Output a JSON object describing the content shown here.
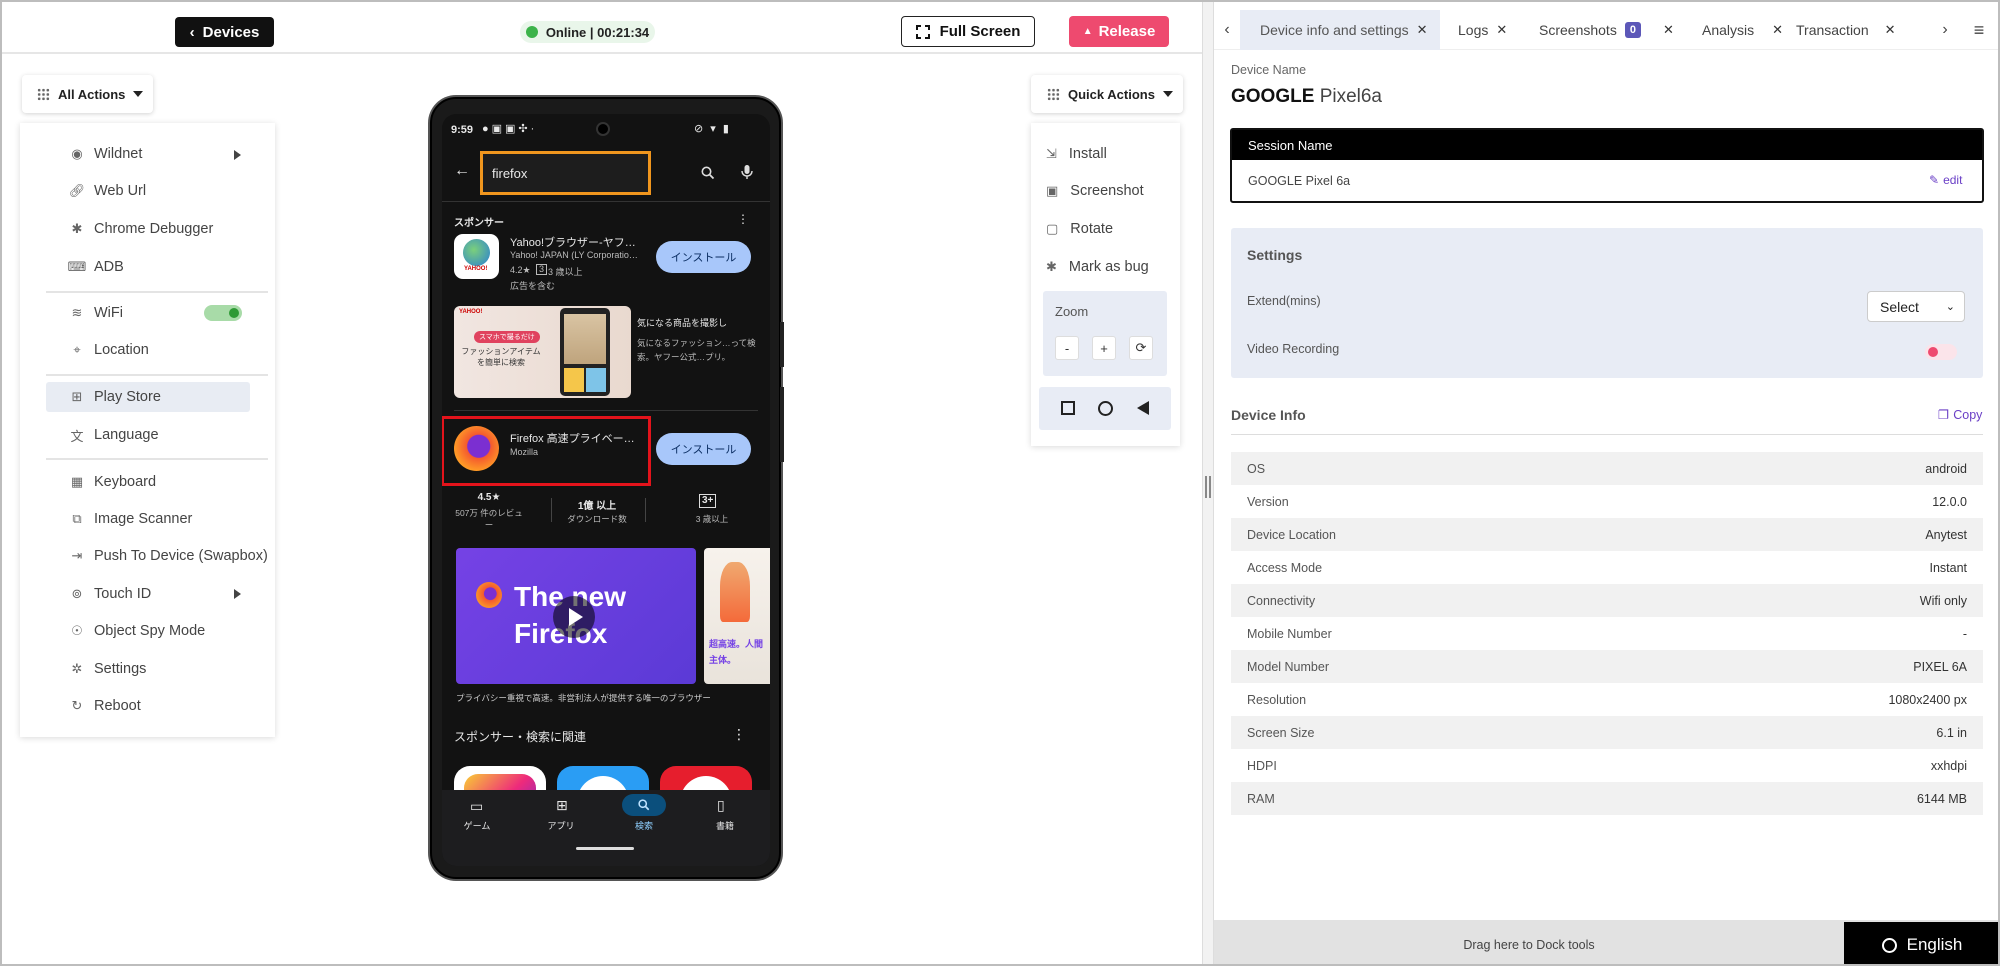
{
  "header": {
    "back_label": "Devices",
    "status_text": "Online | 00:21:34",
    "fullscreen_label": "Full Screen",
    "release_label": "Release"
  },
  "left_actions": {
    "button_label": "All Actions",
    "items": [
      {
        "label": "Wildnet",
        "icon": "signal-icon"
      },
      {
        "label": "Web Url",
        "icon": "link-icon"
      },
      {
        "label": "Chrome Debugger",
        "icon": "bug-icon"
      },
      {
        "label": "ADB",
        "icon": "terminal-icon"
      },
      {
        "label": "WiFi",
        "icon": "wifi-icon",
        "toggle": true
      },
      {
        "label": "Location",
        "icon": "location-pin-icon"
      },
      {
        "label": "Play Store",
        "icon": "apps-icon",
        "active": true
      },
      {
        "label": "Language",
        "icon": "language-icon"
      },
      {
        "label": "Keyboard",
        "icon": "keyboard-icon"
      },
      {
        "label": "Image Scanner",
        "icon": "image-scan-icon"
      },
      {
        "label": "Push To Device (Swapbox)",
        "icon": "push-icon"
      },
      {
        "label": "Touch ID",
        "icon": "fingerprint-icon"
      },
      {
        "label": "Object Spy Mode",
        "icon": "spy-icon"
      },
      {
        "label": "Settings",
        "icon": "gear-icon"
      },
      {
        "label": "Reboot",
        "icon": "reboot-icon"
      }
    ]
  },
  "phone": {
    "time": "9:59",
    "search_query": "firefox",
    "sponsor_label": "スポンサー",
    "yahoo_title": "Yahoo!ブラウザー-ヤフ…",
    "yahoo_dev": "Yahoo! JAPAN (LY Corporatio…",
    "yahoo_rating": "4.2★",
    "yahoo_age": "3 歳以上",
    "yahoo_ads": "広告を含む",
    "install_label": "インストール",
    "banner_tag": "スマホで撮るだけ",
    "banner_text": "ファッションアイテムを簡単に検索",
    "banner_side_title": "気になる商品を撮影し",
    "banner_side_body": "気になるファッション…って検索。ヤフー公式…プリ。",
    "firefox_title": "Firefox 高速プライベー…",
    "firefox_dev": "Mozilla",
    "stat_rating": "4.5★",
    "stat_reviews": "507万 件のレビュー",
    "stat_downloads": "1億 以上",
    "stat_downloads_label": "ダウンロード数",
    "stat_age": "3+",
    "stat_age_label": "3 歳以上",
    "promo_title": "The new Firefox",
    "promo_side": "超高速。人間主体。",
    "promo_caption": "プライバシー重視で高速。非営利法人が提供する唯一のブラウザー",
    "related_label": "スポンサー・検索に関連",
    "nav": [
      "ゲーム",
      "アプリ",
      "検索",
      "書籍"
    ]
  },
  "quick_actions": {
    "button_label": "Quick Actions",
    "items": [
      {
        "label": "Install",
        "icon": "install-icon"
      },
      {
        "label": "Screenshot",
        "icon": "screenshot-icon"
      },
      {
        "label": "Rotate",
        "icon": "rotate-icon"
      },
      {
        "label": "Mark as bug",
        "icon": "bug-icon"
      }
    ],
    "zoom_label": "Zoom",
    "zoom_minus": "-",
    "zoom_plus": "+"
  },
  "tabs": [
    {
      "label": "Device info and settings",
      "active": true
    },
    {
      "label": "Logs"
    },
    {
      "label": "Screenshots",
      "badge": "0"
    },
    {
      "label": "Analysis"
    },
    {
      "label": "Transaction"
    }
  ],
  "device": {
    "name_label": "Device Name",
    "brand": "GOOGLE",
    "model": "Pixel6a",
    "session_header": "Session Name",
    "session_value": "GOOGLE Pixel 6a",
    "edit_label": "edit"
  },
  "settings": {
    "title": "Settings",
    "extend_label": "Extend(mins)",
    "extend_value": "Select",
    "video_label": "Video Recording"
  },
  "device_info": {
    "title": "Device Info",
    "copy_label": "Copy",
    "rows": [
      {
        "k": "OS",
        "v": "android"
      },
      {
        "k": "Version",
        "v": "12.0.0"
      },
      {
        "k": "Device Location",
        "v": "Anytest"
      },
      {
        "k": "Access Mode",
        "v": "Instant"
      },
      {
        "k": "Connectivity",
        "v": "Wifi only"
      },
      {
        "k": "Mobile Number",
        "v": "-"
      },
      {
        "k": "Model Number",
        "v": "PIXEL 6A"
      },
      {
        "k": "Resolution",
        "v": "1080x2400 px"
      },
      {
        "k": "Screen Size",
        "v": "6.1 in"
      },
      {
        "k": "HDPI",
        "v": "xxhdpi"
      },
      {
        "k": "RAM",
        "v": "6144 MB"
      }
    ]
  },
  "footer": {
    "dock_text": "Drag here to Dock tools",
    "language": "English"
  }
}
